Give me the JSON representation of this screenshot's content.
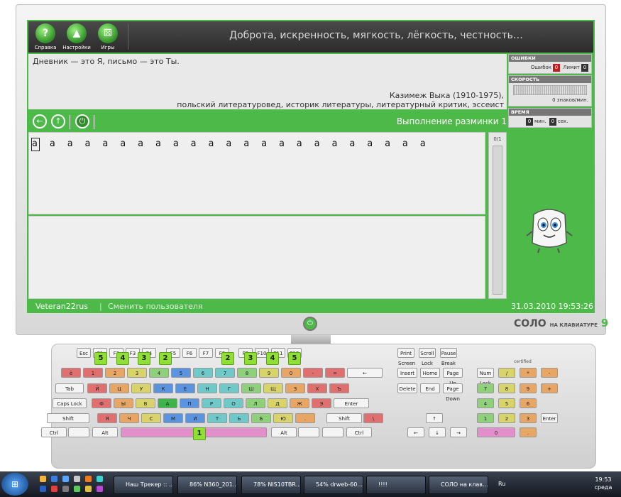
{
  "toolbar": {
    "help": "Справка",
    "settings": "Настройки",
    "games": "Игры",
    "motto": "Доброта, искренность, мягкость, лёгкость, честность…"
  },
  "quote": {
    "text": "Дневник — это Я, письмо — это Ты.",
    "author": "Казимеж Выка (1910-1975),",
    "description": "польский литературовед, историк литературы, литературный критик, эссеист"
  },
  "side": {
    "errors": {
      "title": "ОШИБКИ",
      "errors_label": "Ошибок",
      "errors_value": "0",
      "limit_label": "Лимит",
      "limit_value": "0"
    },
    "speed": {
      "title": "СКОРОСТЬ",
      "value": "0 знаков/мин."
    },
    "time": {
      "title": "ВРЕМЯ",
      "min_value": "0",
      "min_label": "мин.",
      "sec_value": "0",
      "sec_label": "сек."
    }
  },
  "exercise": {
    "status": "Выполнение разминки 1",
    "progress": "0/1",
    "line": "а а а а а а а а а а а а а а а а а а а а а а а"
  },
  "statusbar": {
    "user": "Veteran22rus",
    "change_user": "Сменить пользователя",
    "datetime": "31.03.2010 19:53:26"
  },
  "brand": {
    "name": "СОЛО",
    "sub": "НА КЛАВИАТУРЕ",
    "nine": "9"
  },
  "keyboard": {
    "fkeys": [
      "Esc",
      "F1",
      "F2",
      "F3",
      "F4",
      "F5",
      "F6",
      "F7",
      "F8",
      "F9",
      "F10",
      "F11",
      "F12"
    ],
    "row1": [
      "ё",
      "1",
      "2",
      "3",
      "4",
      "5",
      "6",
      "7",
      "8",
      "9",
      "0",
      "-",
      "=",
      "←"
    ],
    "row2": [
      "Tab",
      "Й",
      "Ц",
      "У",
      "К",
      "Е",
      "Н",
      "Г",
      "Ш",
      "Щ",
      "З",
      "Х",
      "Ъ"
    ],
    "row3": [
      "Caps Lock",
      "Ф",
      "Ы",
      "В",
      "А",
      "П",
      "Р",
      "О",
      "Л",
      "Д",
      "Ж",
      "Э",
      "Enter"
    ],
    "row4": [
      "Shift",
      "Я",
      "Ч",
      "С",
      "М",
      "И",
      "Т",
      "Ь",
      "Б",
      "Ю",
      ".",
      "Shift",
      "\\"
    ],
    "row5": [
      "Ctrl",
      "",
      "Alt",
      "Alt",
      "",
      "",
      "Ctrl"
    ],
    "nav": [
      "Print Screen",
      "Scroll Lock",
      "Pause Break",
      "Insert",
      "Home",
      "Page Up",
      "Delete",
      "End",
      "Page Down",
      "↑",
      "←",
      "↓",
      "→"
    ],
    "numpad": [
      "Num Lock",
      "/",
      "*",
      "-",
      "7",
      "8",
      "9",
      "+",
      "4",
      "5",
      "6",
      "1",
      "2",
      "3",
      "Enter",
      "0",
      "."
    ],
    "certified": "certified",
    "pins_left": [
      "5",
      "4",
      "3",
      "2"
    ],
    "pins_right": [
      "2",
      "3",
      "4",
      "5"
    ],
    "pin_thumb": "1"
  },
  "taskbar": {
    "tasks": [
      "Наш Трекер :: ...",
      "86% N360_201...",
      "78% NIS10TBR...",
      "54% drweb-60...",
      "!!!!",
      "СОЛО на клав..."
    ],
    "lang": "Ru",
    "clock_time": "19:53",
    "clock_day": "среда"
  },
  "colors": {
    "green": "#4cb948",
    "finger_red": "#e07070",
    "finger_orange": "#e8a664",
    "finger_yellow": "#d9d46a",
    "finger_green": "#8fd07a",
    "finger_cyan": "#6fc9c9",
    "finger_blue": "#5a93e0",
    "space_pink": "#e28fcb"
  }
}
